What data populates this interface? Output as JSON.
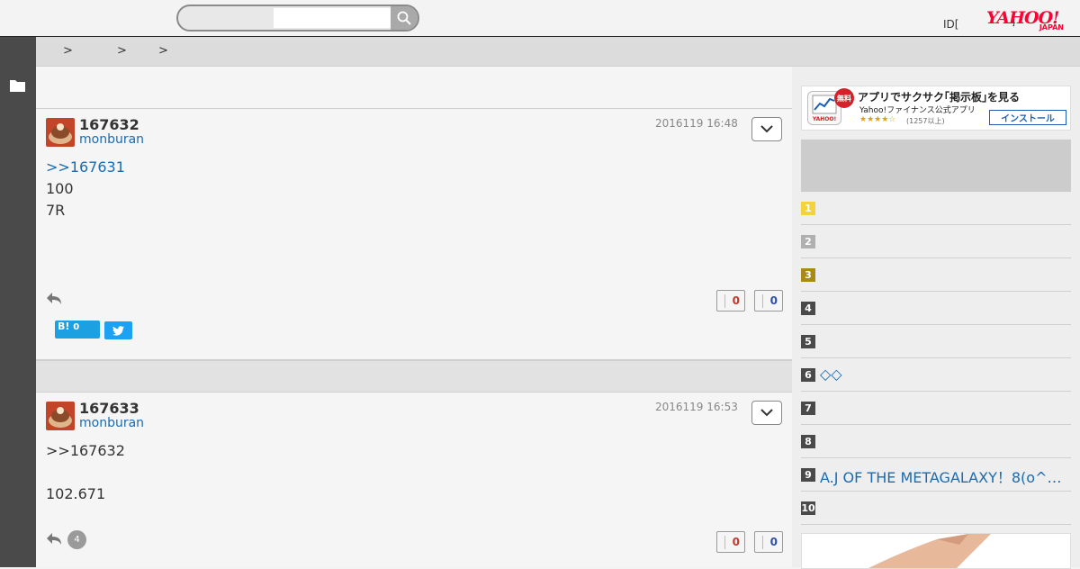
{
  "header": {
    "search_placeholder": "",
    "id_label": "ID[",
    "mark": "]",
    "logo_main": "YAHOO!",
    "logo_sub": "JAPAN"
  },
  "breadcrumb": {
    "separators": [
      ">",
      ">",
      ">"
    ]
  },
  "posts": [
    {
      "number": "167632",
      "user": "monburan",
      "date": "2016119 16:48",
      "reply_link": ">>167631",
      "lines": [
        "100",
        "7R"
      ],
      "likes": "0",
      "dislikes": "0",
      "hatena_label": "B!",
      "hatena_count": "0"
    },
    {
      "number": "167633",
      "user": "monburan",
      "date": "2016119 16:53",
      "reply_link": ">>167632",
      "lines": [
        "102.671"
      ],
      "reply_count": "4",
      "likes": "0",
      "dislikes": "0"
    }
  ],
  "ad": {
    "free_badge": "無料",
    "title": "アプリでサクサク｢掲示板｣を見る",
    "subtitle": "Yahoo!ファイナンス公式アプリ",
    "stars": "★★★★☆",
    "review_count": "(1257以上)",
    "install_label": "インストール",
    "icon_text": "YAHOO!"
  },
  "ranking": [
    {
      "rank": "1",
      "title": ""
    },
    {
      "rank": "2",
      "title": ""
    },
    {
      "rank": "3",
      "title": ""
    },
    {
      "rank": "4",
      "title": ""
    },
    {
      "rank": "5",
      "title": ""
    },
    {
      "rank": "6",
      "title": "◇◇"
    },
    {
      "rank": "7",
      "title": ""
    },
    {
      "rank": "8",
      "title": ""
    },
    {
      "rank": "9",
      "title": "A.J OF THE METAGALAXY！8(o^…"
    },
    {
      "rank": "10",
      "title": ""
    }
  ]
}
